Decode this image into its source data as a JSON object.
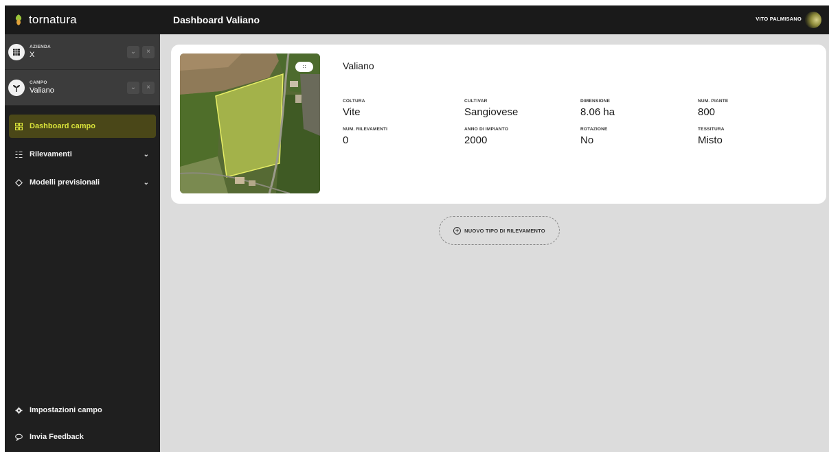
{
  "brand": {
    "name": "tornatura",
    "logo_icon": "leaf-icon"
  },
  "header": {
    "title": "Dashboard Valiano",
    "user_name": "VITO PALMISANO"
  },
  "selectors": {
    "company": {
      "label": "AZIENDA",
      "value": "X",
      "icon": "farm-icon"
    },
    "field": {
      "label": "CAMPO",
      "value": "Valiano",
      "icon": "sprout-icon"
    }
  },
  "nav": {
    "items": [
      {
        "label": "Dashboard campo",
        "icon": "grid-icon",
        "active": true
      },
      {
        "label": "Rilevamenti",
        "icon": "list-icon",
        "expandable": true
      },
      {
        "label": "Modelli previsionali",
        "icon": "diamond-icon",
        "expandable": true
      }
    ],
    "bottom": [
      {
        "label": "Impostazioni campo",
        "icon": "gear-icon"
      },
      {
        "label": "Invia Feedback",
        "icon": "chat-icon"
      }
    ]
  },
  "field_card": {
    "name": "Valiano",
    "stats": [
      {
        "label": "COLTURA",
        "value": "Vite"
      },
      {
        "label": "CULTIVAR",
        "value": "Sangiovese"
      },
      {
        "label": "DIMENSIONE",
        "value": "8.06 ha"
      },
      {
        "label": "NUM. PIANTE",
        "value": "800"
      },
      {
        "label": "NUM. RILEVAMENTI",
        "value": "0"
      },
      {
        "label": "ANNO DI IMPIANTO",
        "value": "2000"
      },
      {
        "label": "ROTAZIONE",
        "value": "No"
      },
      {
        "label": "TESSITURA",
        "value": "Misto"
      }
    ]
  },
  "actions": {
    "new_survey_type": "NUOVO TIPO DI RILEVAMENTO"
  },
  "colors": {
    "accent": "#d9e33a",
    "active_bg": "#4a4718",
    "sidebar": "#1f1f1f",
    "content_bg": "#dcdcdc"
  }
}
